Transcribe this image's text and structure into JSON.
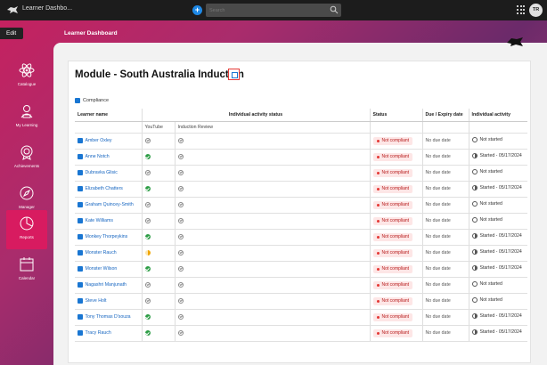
{
  "topbar": {
    "app_title": "Learner Dashbo...",
    "search_placeholder": "Search",
    "avatar_initials": "TR"
  },
  "edit_label": "Edit",
  "page_heading": "Learner Dashboard",
  "sidebar": {
    "items": [
      {
        "label": "Catalogue",
        "icon": "atom-icon"
      },
      {
        "label": "My Learning",
        "icon": "learner-icon"
      },
      {
        "label": "Achievements",
        "icon": "badge-icon"
      },
      {
        "label": "Manager",
        "icon": "compass-icon"
      },
      {
        "label": "Reports",
        "icon": "pie-chart-icon",
        "active": true
      },
      {
        "label": "Calendar",
        "icon": "calendar-icon"
      }
    ]
  },
  "module": {
    "title": "Module - South Australia Induction",
    "compliance_label": "Compliance"
  },
  "table": {
    "headers": {
      "learner": "Learner name",
      "activity_status": "Individual activity status",
      "status": "Status",
      "due": "Due / Expiry date",
      "individual": "Individual activity"
    },
    "sub_headers": [
      "YouTube",
      "Induction Review"
    ],
    "rows": [
      {
        "name": "Amber Oxley",
        "youtube": "none",
        "review": "none",
        "status": "Not compliant",
        "due": "No due date",
        "activity": "Not started",
        "started": false
      },
      {
        "name": "Anne Notch",
        "youtube": "done",
        "review": "none",
        "status": "Not compliant",
        "due": "No due date",
        "activity": "Started - 05/17/2024",
        "started": true
      },
      {
        "name": "Dubravka Glisic",
        "youtube": "none",
        "review": "none",
        "status": "Not compliant",
        "due": "No due date",
        "activity": "Not started",
        "started": false
      },
      {
        "name": "Elizabeth Chatters",
        "youtube": "done",
        "review": "none",
        "status": "Not compliant",
        "due": "No due date",
        "activity": "Started - 05/17/2024",
        "started": true
      },
      {
        "name": "Graham Quincey-Smith",
        "youtube": "none",
        "review": "none",
        "status": "Not compliant",
        "due": "No due date",
        "activity": "Not started",
        "started": false
      },
      {
        "name": "Kate Williams",
        "youtube": "none",
        "review": "none",
        "status": "Not compliant",
        "due": "No due date",
        "activity": "Not started",
        "started": false
      },
      {
        "name": "Monkey Thorpeykins",
        "youtube": "done",
        "review": "none",
        "status": "Not compliant",
        "due": "No due date",
        "activity": "Started - 05/17/2024",
        "started": true
      },
      {
        "name": "Monster Rauch",
        "youtube": "progress",
        "review": "none",
        "status": "Not compliant",
        "due": "No due date",
        "activity": "Started - 05/17/2024",
        "started": true
      },
      {
        "name": "Monster Wilson",
        "youtube": "done",
        "review": "none",
        "status": "Not compliant",
        "due": "No due date",
        "activity": "Started - 05/17/2024",
        "started": true
      },
      {
        "name": "Nagashri Manjunath",
        "youtube": "none",
        "review": "none",
        "status": "Not compliant",
        "due": "No due date",
        "activity": "Not started",
        "started": false
      },
      {
        "name": "Steve Holt",
        "youtube": "none",
        "review": "none",
        "status": "Not compliant",
        "due": "No due date",
        "activity": "Not started",
        "started": false
      },
      {
        "name": "Tony Thomas D'souza",
        "youtube": "done",
        "review": "none",
        "status": "Not compliant",
        "due": "No due date",
        "activity": "Started - 05/17/2024",
        "started": true
      },
      {
        "name": "Tracy Rauch",
        "youtube": "done",
        "review": "none",
        "status": "Not compliant",
        "due": "No due date",
        "activity": "Started - 05/17/2024",
        "started": true
      }
    ]
  }
}
